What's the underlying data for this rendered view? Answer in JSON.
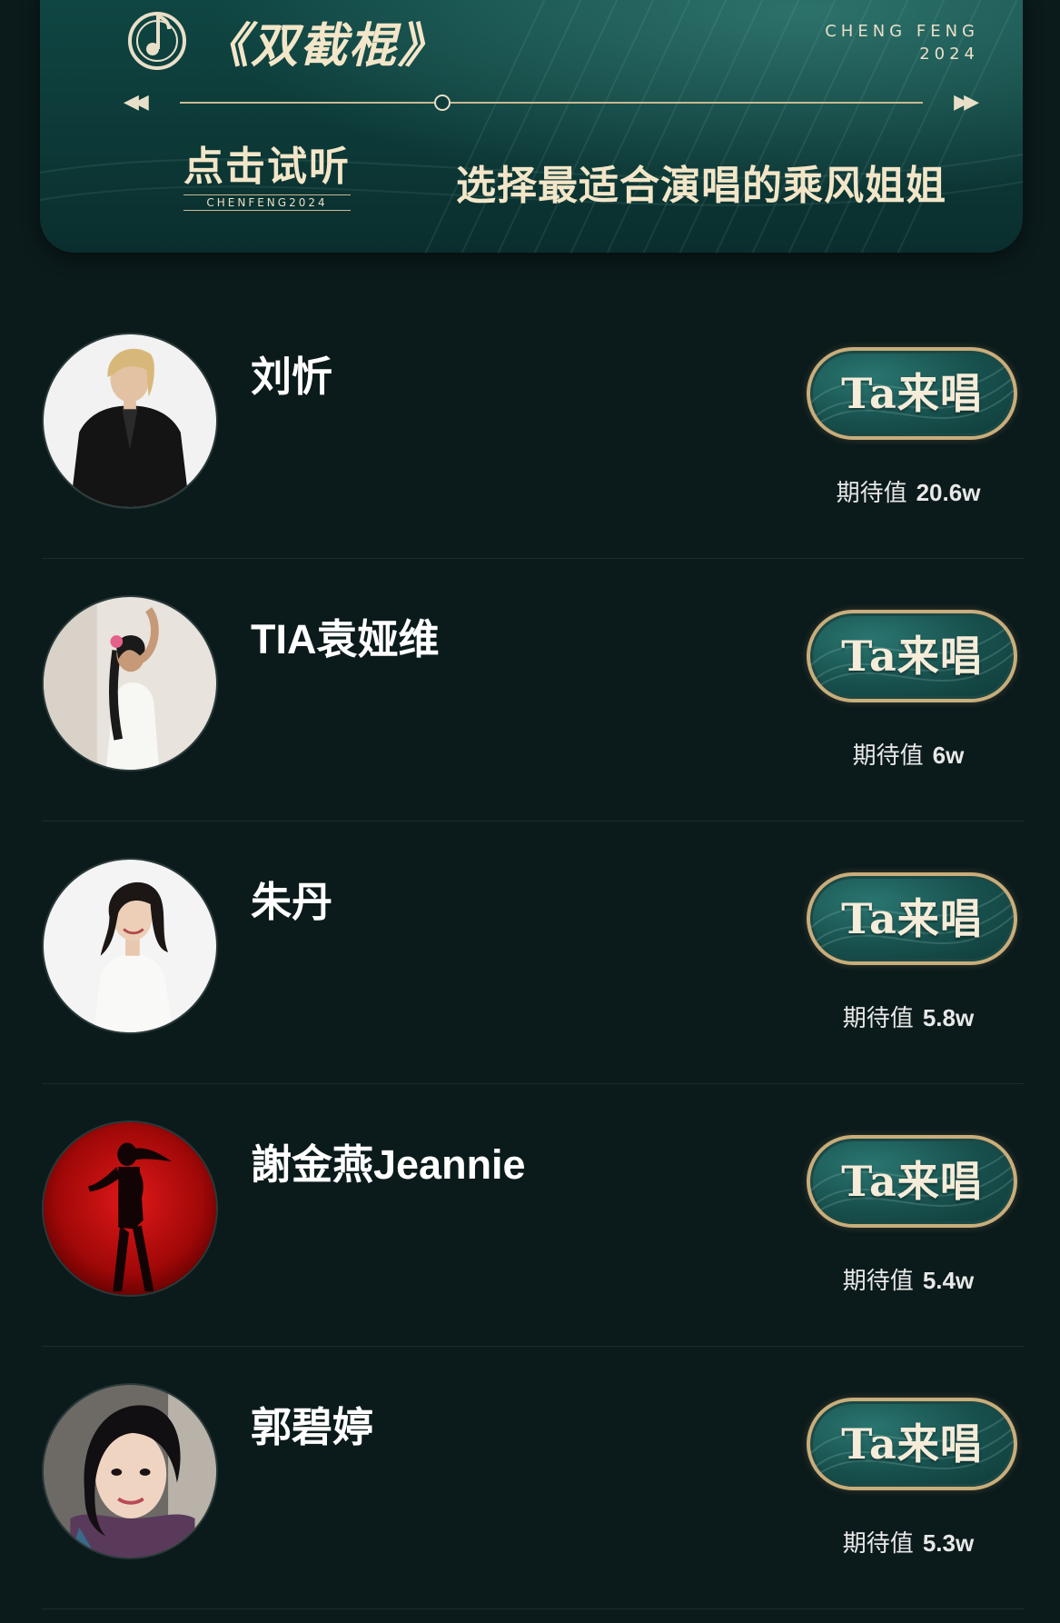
{
  "banner": {
    "song_title": "《双截棍》",
    "brand_line1": "CHENG FENG",
    "brand_line2": "2024",
    "rewind_glyph": "◀◀",
    "forward_glyph": "▶▶",
    "listen_label": "点击试听",
    "listen_sub": "CHENFENG2024",
    "tagline": "选择最适合演唱的乘风姐姐"
  },
  "contestants": [
    {
      "name": "刘忻",
      "button_label": "Ta来唱",
      "expect_label": "期待值",
      "expect_value": "20.6w",
      "avatar": "portrait-black-suit"
    },
    {
      "name": "TIA袁娅维",
      "button_label": "Ta来唱",
      "expect_label": "期待值",
      "expect_value": "6w",
      "avatar": "portrait-white-dress"
    },
    {
      "name": "朱丹",
      "button_label": "Ta来唱",
      "expect_label": "期待值",
      "expect_value": "5.8w",
      "avatar": "portrait-smiling"
    },
    {
      "name": "謝金燕Jeannie",
      "button_label": "Ta来唱",
      "expect_label": "期待值",
      "expect_value": "5.4w",
      "avatar": "silhouette-red"
    },
    {
      "name": "郭碧婷",
      "button_label": "Ta来唱",
      "expect_label": "期待值",
      "expect_value": "5.3w",
      "avatar": "portrait-selfie"
    }
  ],
  "colors": {
    "background": "#0b1a1b",
    "banner_teal": "#0f4643",
    "gold": "#c9ad7a",
    "cream_text": "#f3e6c8"
  }
}
